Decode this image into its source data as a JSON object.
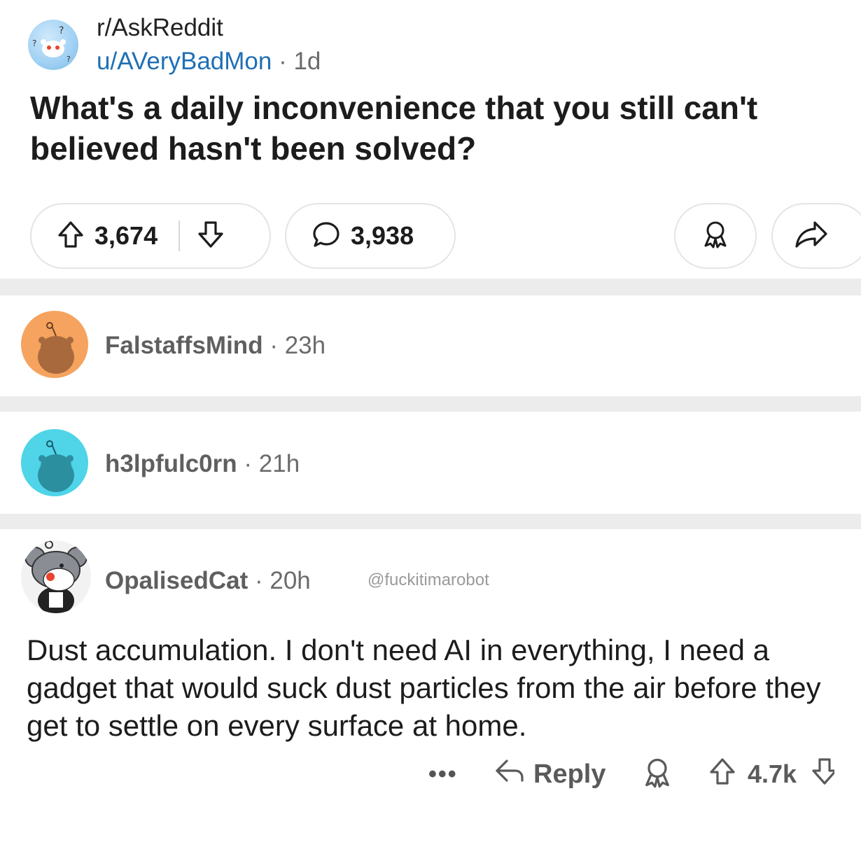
{
  "post": {
    "subreddit": "r/AskReddit",
    "author": "u/AVeryBadMon",
    "separator": "·",
    "age": "1d",
    "title": "What's a daily inconvenience that you still can't believed hasn't been solved?",
    "upvotes": "3,674",
    "comments": "3,938"
  },
  "comments": [
    {
      "user": "FalstaffsMind",
      "age": "23h",
      "avatar_color": "#f5a35e"
    },
    {
      "user": "h3lpfulc0rn",
      "age": "21h",
      "avatar_color": "#4fd4e8"
    },
    {
      "user": "OpalisedCat",
      "age": "20h",
      "watermark": "@fuckitimarobot",
      "body": "Dust accumulation. I don't need AI in everything, I need a gadget that would suck dust particles from the air before they get to settle on every surface at home.",
      "score": "4.7k",
      "more": "•••",
      "reply_label": "Reply"
    }
  ],
  "icons": [
    "upvote-icon",
    "downvote-icon",
    "comment-icon",
    "award-icon",
    "share-icon",
    "reply-icon",
    "more-icon"
  ],
  "colors": {
    "link": "#1f6fb4",
    "separator": "#ececec",
    "pill_border": "#e4e4e4"
  }
}
